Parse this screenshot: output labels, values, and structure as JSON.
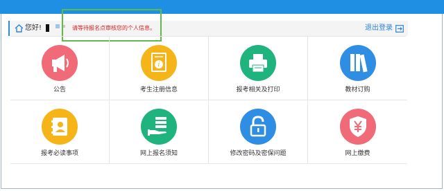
{
  "header": {
    "greeting": "您好!",
    "warning": "请等待报名点审核您的个人信息。",
    "logout_label": "退出登录"
  },
  "menu": [
    {
      "label": "公告",
      "icon": "megaphone-icon",
      "color": "#f06a78"
    },
    {
      "label": "考生注册信息",
      "icon": "info-document-icon",
      "color": "#f5b417"
    },
    {
      "label": "报考相关及打印",
      "icon": "printer-icon",
      "color": "#1fb37e"
    },
    {
      "label": "教材订购",
      "icon": "books-icon",
      "color": "#2f8de4"
    },
    {
      "label": "报考必读事项",
      "icon": "contact-book-icon",
      "color": "#f5b417"
    },
    {
      "label": "网上报名须知",
      "icon": "hand-stack-icon",
      "color": "#1fb37e"
    },
    {
      "label": "修改密码及密保问题",
      "icon": "padlock-icon",
      "color": "#2f8de4"
    },
    {
      "label": "网上缴费",
      "icon": "yen-shield-icon",
      "color": "#f06a78"
    }
  ],
  "colors": {
    "topbar": "#1f8fe3",
    "warning_text": "#e02020",
    "highlight_box": "#5dbb46"
  }
}
